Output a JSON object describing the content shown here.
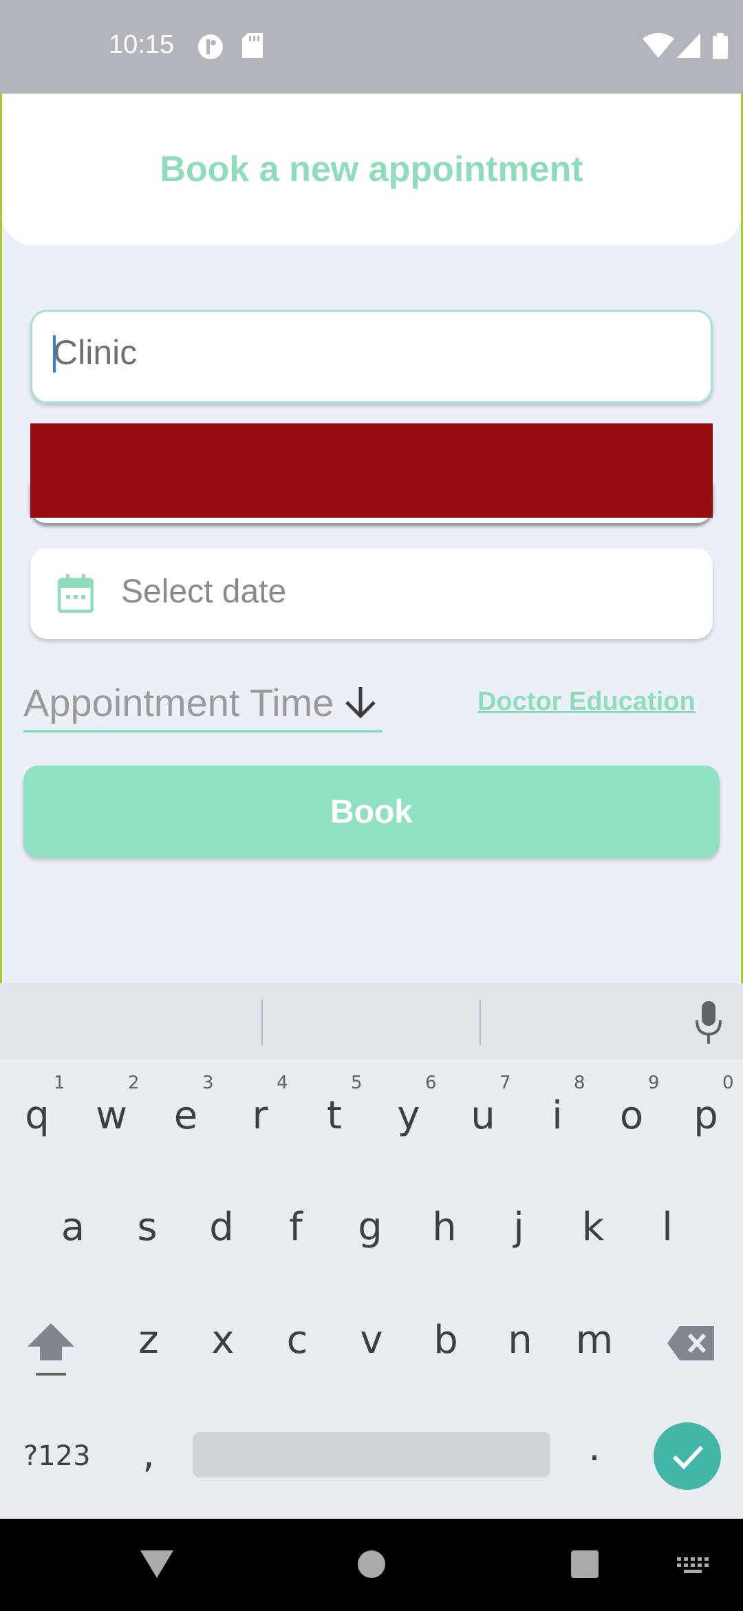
{
  "status_bar": {
    "time": "10:15"
  },
  "header": {
    "title": "Book a new appointment"
  },
  "form": {
    "clinic_value": "Clinic",
    "date_placeholder": "Select date",
    "time_label": "Appointment Time",
    "doctor_education_link": "Doctor Education",
    "book_label": "Book"
  },
  "keyboard": {
    "row1": [
      "q",
      "w",
      "e",
      "r",
      "t",
      "y",
      "u",
      "i",
      "o",
      "p"
    ],
    "row1_hints": [
      "1",
      "2",
      "3",
      "4",
      "5",
      "6",
      "7",
      "8",
      "9",
      "0"
    ],
    "row2": [
      "a",
      "s",
      "d",
      "f",
      "g",
      "h",
      "j",
      "k",
      "l"
    ],
    "row3": [
      "z",
      "x",
      "c",
      "v",
      "b",
      "n",
      "m"
    ],
    "symbols_label": "?123",
    "comma": ",",
    "period": "."
  },
  "colors": {
    "accent": "#8fdcbd",
    "button": "#91e1c0",
    "enter": "#43b6a8"
  }
}
